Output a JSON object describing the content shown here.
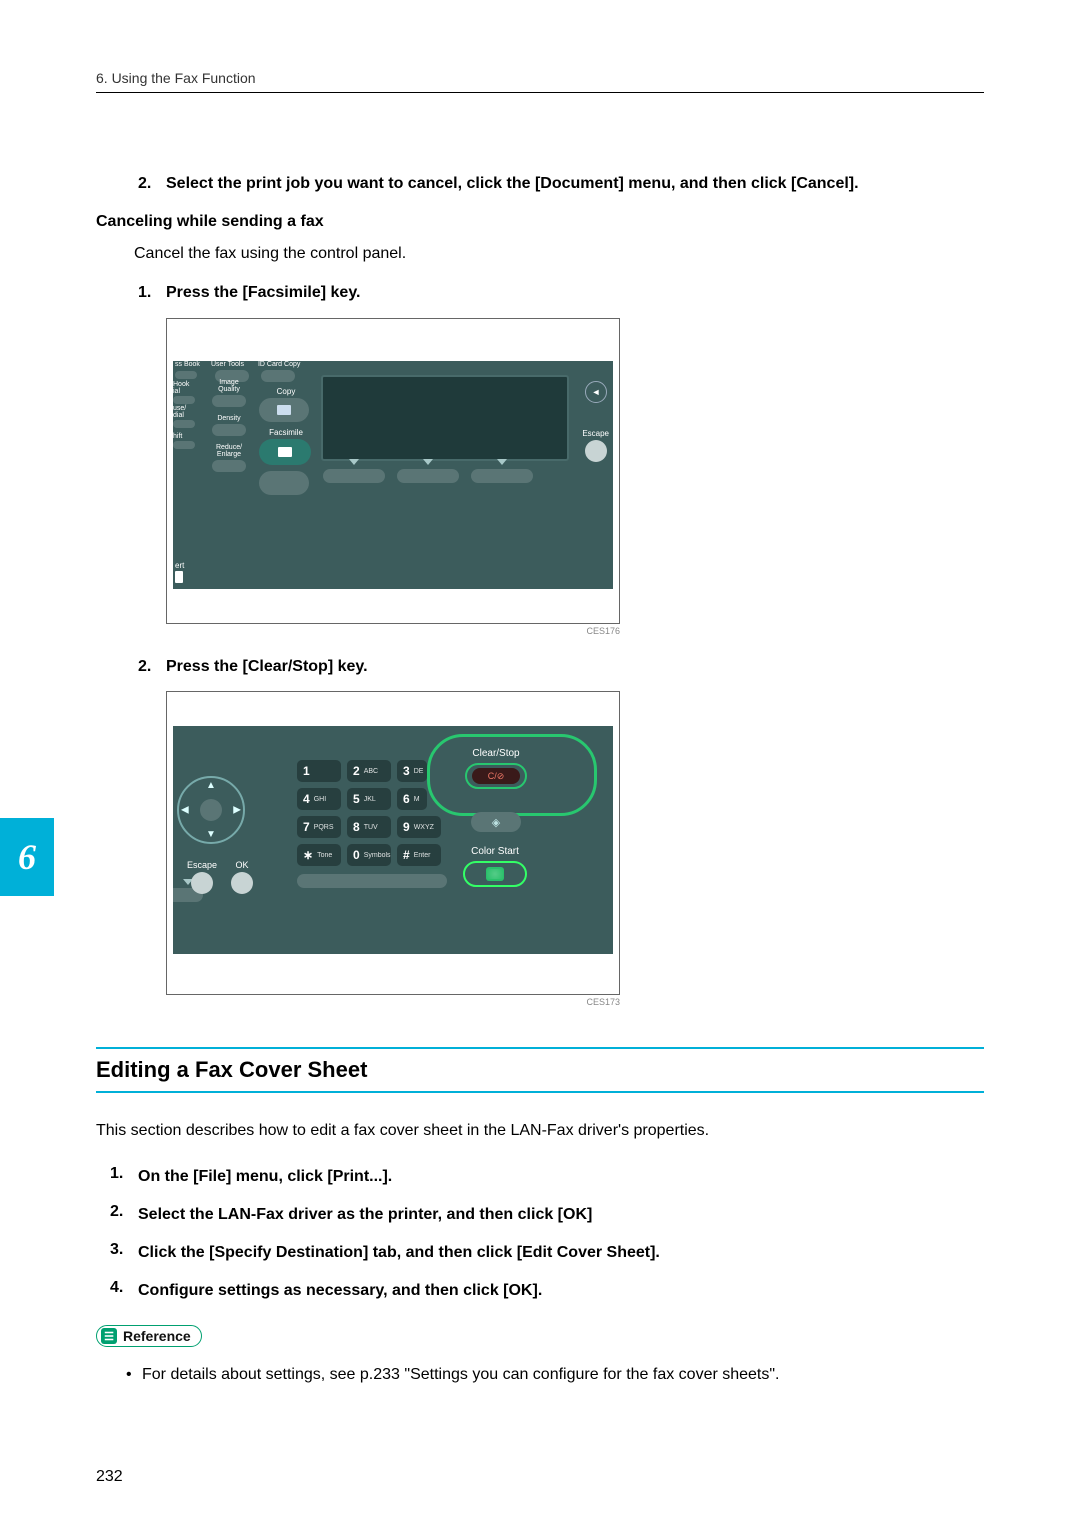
{
  "header": {
    "text": "6. Using the Fax Function"
  },
  "chapter_tab": "6",
  "top_steps": {
    "s2_num": "2.",
    "s2_text": "Select the print job you want to cancel, click the [Document] menu, and then click [Cancel]."
  },
  "cancel_heading": "Canceling while sending a fax",
  "cancel_body": "Cancel the fax using the control panel.",
  "cancel_steps": {
    "s1_num": "1.",
    "s1_text": "Press the [Facsimile] key.",
    "s2_num": "2.",
    "s2_text": "Press the [Clear/Stop] key."
  },
  "fig1": {
    "caption": "CES176",
    "labels": {
      "top1": "ss Book",
      "top2": "User Tools",
      "top3": "ID Card Copy",
      "hook": "Hook",
      "ial": "ial",
      "img_q1": "Image",
      "img_q2": "Quality",
      "copy": "Copy",
      "use": "use/",
      "dial": "dial",
      "density": "Density",
      "facsimile": "Facsimile",
      "hift": "hift",
      "reduce1": "Reduce/",
      "reduce2": "Enlarge",
      "ert": "ert",
      "escape": "Escape"
    }
  },
  "fig2": {
    "caption": "CES173",
    "labels": {
      "escape": "Escape",
      "ok": "OK",
      "clear": "Clear/Stop",
      "clear_btn": "C/⊘",
      "color": "Color Start",
      "keys": {
        "k1": "1",
        "k2": "2",
        "k2s": "ABC",
        "k3": "3",
        "k3s": "DE",
        "k4": "4",
        "k4s": "GHI",
        "k5": "5",
        "k5s": "JKL",
        "k6": "6",
        "k6s": "M",
        "k7": "7",
        "k7s": "PQRS",
        "k8": "8",
        "k8s": "TUV",
        "k9": "9",
        "k9s": "WXYZ",
        "ks": "∗",
        "kss": "Tone",
        "k0": "0",
        "k0s": "Symbols",
        "kh": "#",
        "khs": "Enter"
      }
    }
  },
  "section2": {
    "title": "Editing a Fax Cover Sheet",
    "intro": "This section describes how to edit a fax cover sheet in the LAN-Fax driver's properties.",
    "s1_num": "1.",
    "s1_text": "On the [File] menu, click [Print...].",
    "s2_num": "2.",
    "s2_text": "Select the LAN-Fax driver as the printer, and then click [OK]",
    "s3_num": "3.",
    "s3_text": "Click the [Specify Destination] tab, and then click [Edit Cover Sheet].",
    "s4_num": "4.",
    "s4_text": "Configure settings as necessary, and then click [OK]."
  },
  "reference": {
    "badge": "Reference",
    "bullet": "For details about settings, see p.233 \"Settings you can configure for the fax cover sheets\"."
  },
  "page_number": "232"
}
